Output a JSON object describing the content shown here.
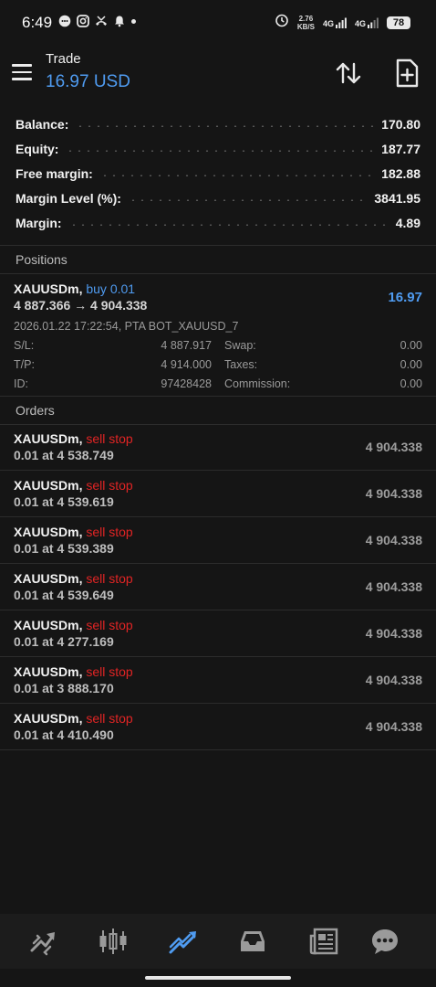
{
  "status_bar": {
    "time": "6:49",
    "speed_value": "2.76",
    "speed_unit": "KB/S",
    "network_1": "4G",
    "network_2": "4G",
    "battery": "78"
  },
  "header": {
    "title": "Trade",
    "profit": "16.97 USD"
  },
  "summary": [
    {
      "label": "Balance:",
      "value": "170.80"
    },
    {
      "label": "Equity:",
      "value": "187.77"
    },
    {
      "label": "Free margin:",
      "value": "182.88"
    },
    {
      "label": "Margin Level (%):",
      "value": "3841.95"
    },
    {
      "label": "Margin:",
      "value": "4.89"
    }
  ],
  "positions_section": "Positions",
  "position": {
    "symbol": "XAUUSDm,",
    "type": "buy 0.01",
    "prices": "4 887.366 → 4 904.338",
    "profit": "16.97",
    "meta": "2026.01.22 17:22:54, PTA BOT_XAUUSD_7",
    "sl_label": "S/L:",
    "sl_value": "4 887.917",
    "swap_label": "Swap:",
    "swap_value": "0.00",
    "tp_label": "T/P:",
    "tp_value": "4 914.000",
    "taxes_label": "Taxes:",
    "taxes_value": "0.00",
    "id_label": "ID:",
    "id_value": "97428428",
    "commission_label": "Commission:",
    "commission_value": "0.00"
  },
  "orders_section": "Orders",
  "orders": [
    {
      "symbol": "XAUUSDm,",
      "type": "sell stop",
      "volume": "0.01 at 4 538.749",
      "price": "4 904.338"
    },
    {
      "symbol": "XAUUSDm,",
      "type": "sell stop",
      "volume": "0.01 at 4 539.619",
      "price": "4 904.338"
    },
    {
      "symbol": "XAUUSDm,",
      "type": "sell stop",
      "volume": "0.01 at 4 539.389",
      "price": "4 904.338"
    },
    {
      "symbol": "XAUUSDm,",
      "type": "sell stop",
      "volume": "0.01 at 4 539.649",
      "price": "4 904.338"
    },
    {
      "symbol": "XAUUSDm,",
      "type": "sell stop",
      "volume": "0.01 at 4 277.169",
      "price": "4 904.338"
    },
    {
      "symbol": "XAUUSDm,",
      "type": "sell stop",
      "volume": "0.01 at 3 888.170",
      "price": "4 904.338"
    },
    {
      "symbol": "XAUUSDm,",
      "type": "sell stop",
      "volume": "0.01 at 4 410.490",
      "price": "4 904.338"
    }
  ],
  "bottom_nav": [
    {
      "icon": "quotes-icon"
    },
    {
      "icon": "chart-icon"
    },
    {
      "icon": "trade-icon",
      "active": true
    },
    {
      "icon": "history-icon"
    },
    {
      "icon": "news-icon"
    },
    {
      "icon": "messages-icon"
    }
  ],
  "colors": {
    "accent": "#4f9bf0",
    "sell": "#e02424",
    "background": "#151515"
  }
}
